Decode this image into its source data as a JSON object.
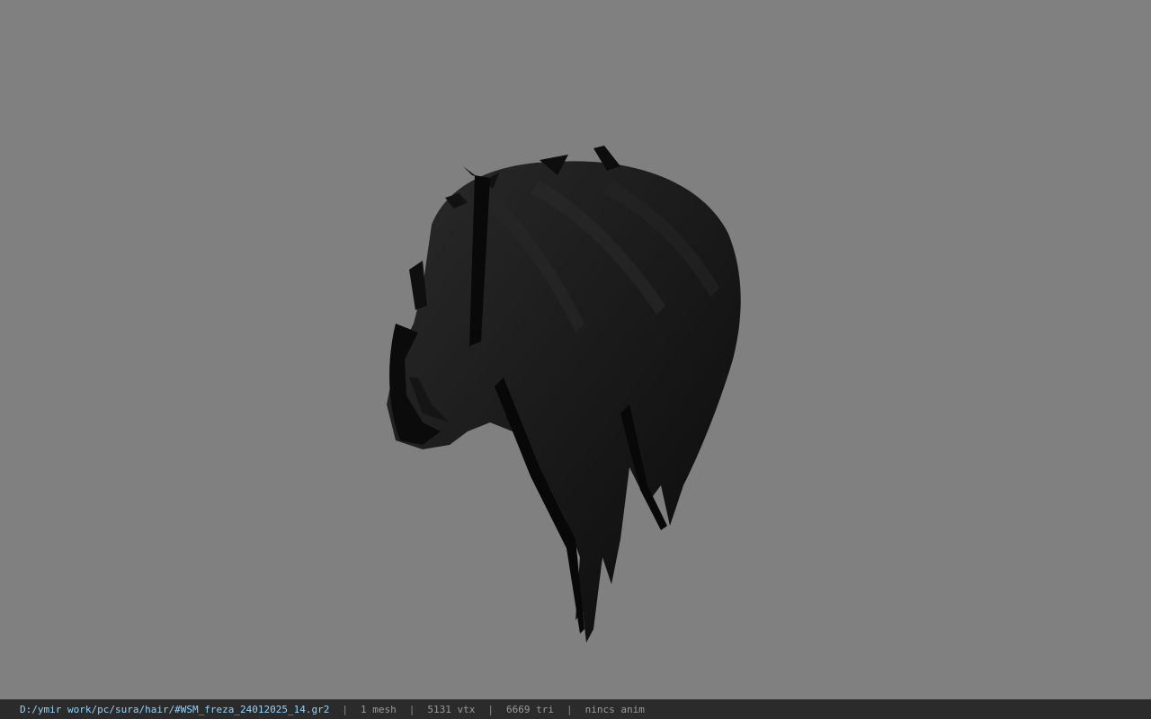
{
  "viewport": {
    "background_color": "#808080",
    "model_color": "#141414",
    "model_icon": "hair-model"
  },
  "statusbar": {
    "file_path": "D:/ymir work/pc/sura/hair/#WSM_freza_24012025_14.gr2",
    "separator": "|",
    "mesh": "1 mesh",
    "vertices": "5131 vtx",
    "triangles": "6669 tri",
    "anim": "nincs anim",
    "path_color": "#8fd3ff"
  }
}
